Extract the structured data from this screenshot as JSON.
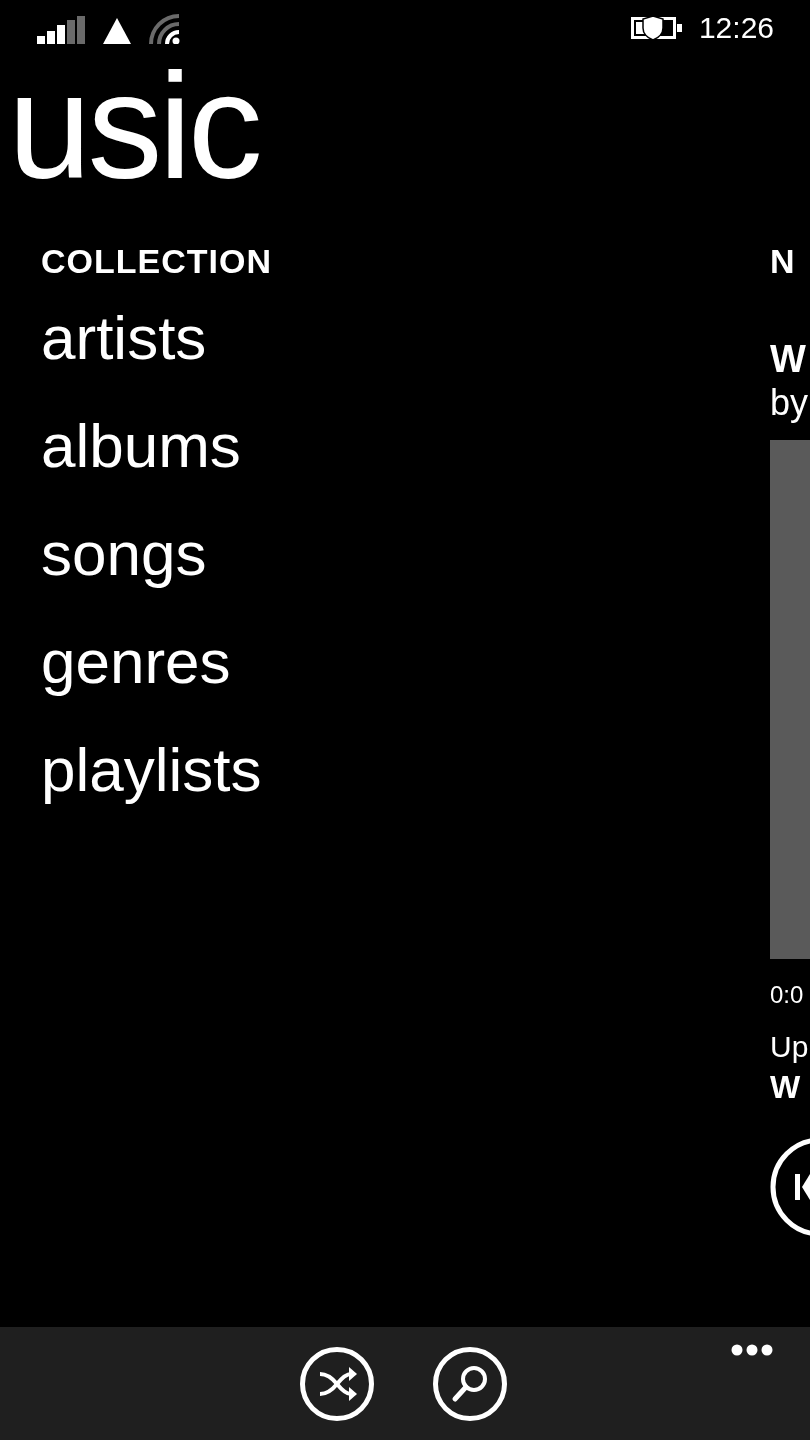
{
  "status_bar": {
    "time": "12:26"
  },
  "title": "usic",
  "collection": {
    "header": "COLLECTION",
    "items": [
      "artists",
      "albums",
      "songs",
      "genres",
      "playlists"
    ]
  },
  "now_playing": {
    "header": "N",
    "track": "W",
    "artist": "by",
    "elapsed": "0:0",
    "up_next_label": "Up",
    "up_next_track": "W"
  },
  "app_bar": {
    "buttons": [
      {
        "kind": "shuffle"
      },
      {
        "kind": "search"
      }
    ]
  }
}
